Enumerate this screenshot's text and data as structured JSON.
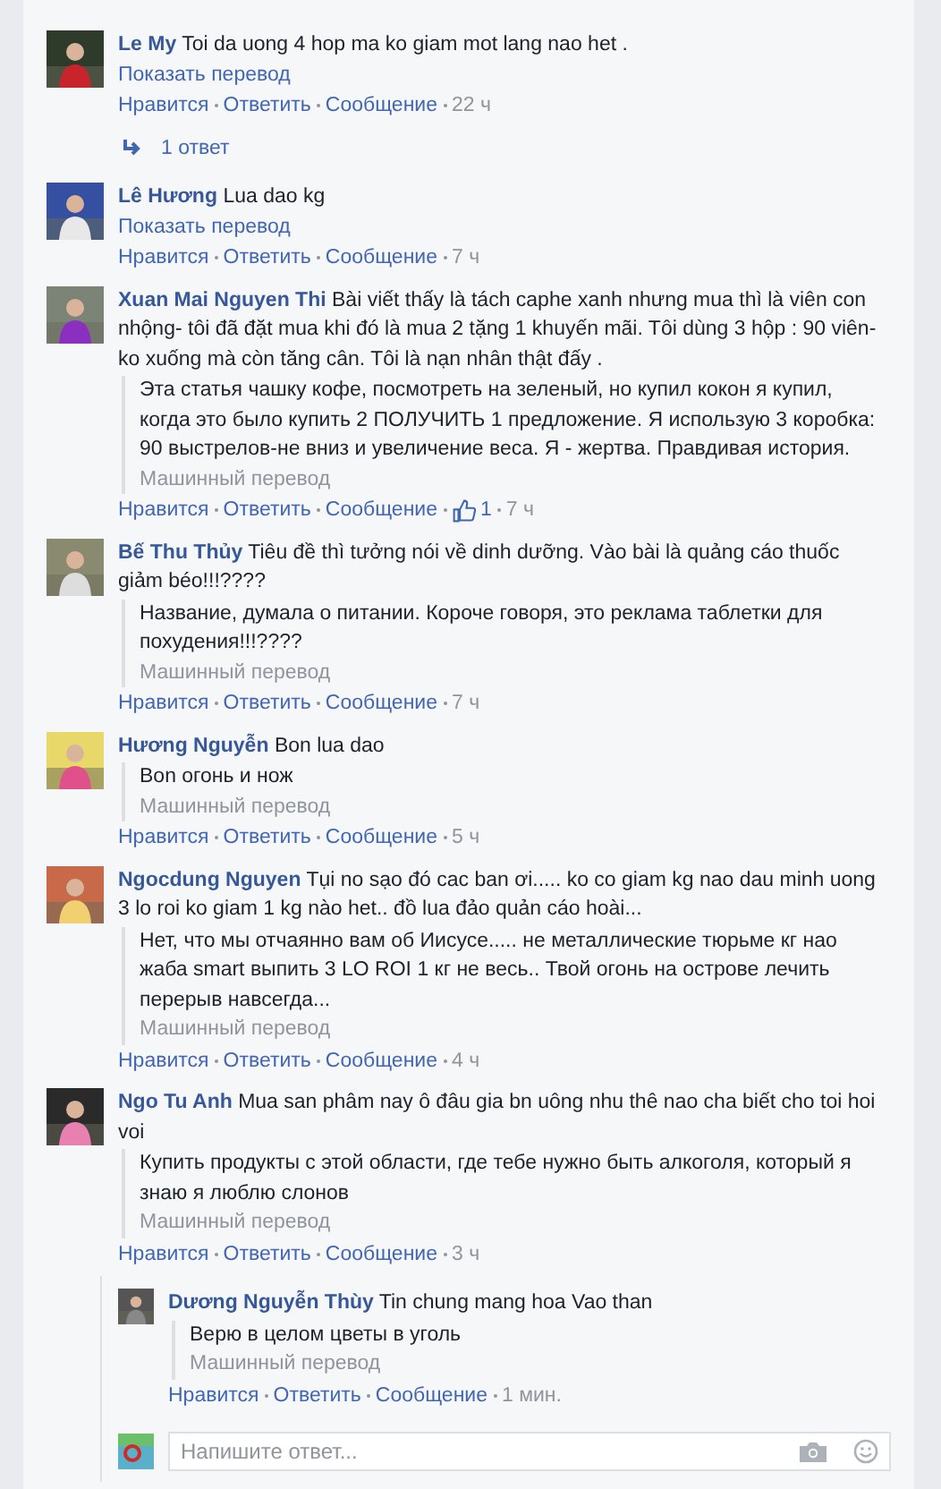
{
  "comments": [
    {
      "author": "Le My",
      "text": "Toi da uong 4 hop ma ko giam mot lang nao het .",
      "show_translation": "Показать перевод",
      "actions": [
        "Нравится",
        "Ответить",
        "Сообщение"
      ],
      "time": "22 ч",
      "replies_link": "1 ответ"
    },
    {
      "author": "Lê Hương",
      "text": "Lua dao kg",
      "show_translation": "Показать перевод",
      "actions": [
        "Нравится",
        "Ответить",
        "Сообщение"
      ],
      "time": "7 ч"
    },
    {
      "author": "Xuan Mai Nguyen Thi",
      "text": "Bài viết thấy là tách caphe xanh nhưng mua thì là viên con nhộng- tôi đã đặt mua khi đó là mua 2 tặng 1 khuyến mãi. Tôi dùng 3 hộp : 90 viên- ko xuống mà còn tăng cân. Tôi là nạn nhân thật đấy .",
      "translation": {
        "text": "Эта статья чашку кофе, посмотреть на зеленый, но купил кокон я купил, когда это было купить 2 ПОЛУЧИТЬ 1 предложение. Я использую 3 коробка: 90 выстрелов-не вниз и увеличение веса. Я - жертва. Правдивая история.",
        "label": "Машинный перевод"
      },
      "actions": [
        "Нравится",
        "Ответить",
        "Сообщение"
      ],
      "likes": "1",
      "time": "7 ч"
    },
    {
      "author": "Bế Thu Thủy",
      "text": "Tiêu đề thì tưởng nói về dinh dưỡng. Vào bài là quảng cáo thuốc giảm béo!!!????",
      "translation": {
        "text": "Название, думала о питании. Короче говоря, это реклама таблетки для похудения!!!????",
        "label": "Машинный перевод"
      },
      "actions": [
        "Нравится",
        "Ответить",
        "Сообщение"
      ],
      "time": "7 ч"
    },
    {
      "author": "Hương Nguyễn",
      "text": "Bon lua dao",
      "translation": {
        "text": "Bon огонь и нож",
        "label": "Машинный перевод"
      },
      "actions": [
        "Нравится",
        "Ответить",
        "Сообщение"
      ],
      "time": "5 ч"
    },
    {
      "author": "Ngocdung Nguyen",
      "text": "Tụi no sạo đó cac ban ơi..... ko co giam kg nao dau minh uong 3 lo roi ko giam 1 kg nào het.. đồ lua đảo quản cáo hoài...",
      "translation": {
        "text": "Нет, что мы отчаянно вам об Иисусе..... не металлические тюрьме кг нао жаба smart выпить 3 LO ROI 1 кг не весь.. Твой огонь на острове лечить перерыв навсегда...",
        "label": "Машинный перевод"
      },
      "actions": [
        "Нравится",
        "Ответить",
        "Сообщение"
      ],
      "time": "4 ч"
    },
    {
      "author": "Ngo Tu Anh",
      "text": "Mua san phâm nay ô đâu gia bn uông nhu thê nao cha biết cho toi hoi voi",
      "translation": {
        "text": "Купить продукты с этой области, где тебе нужно быть алкоголя, который я знаю я люблю слонов",
        "label": "Машинный перевод"
      },
      "actions": [
        "Нравится",
        "Ответить",
        "Сообщение"
      ],
      "time": "3 ч",
      "replies": [
        {
          "author": "Dương Nguyễn Thùy",
          "text": "Tin chung mang hoa Vao than",
          "translation": {
            "text": "Верю в целом цветы в уголь",
            "label": "Машинный перевод"
          },
          "actions": [
            "Нравится",
            "Ответить",
            "Сообщение"
          ],
          "time": "1 мин."
        }
      ],
      "reply_box": {
        "placeholder": "Напишите ответ..."
      }
    }
  ]
}
